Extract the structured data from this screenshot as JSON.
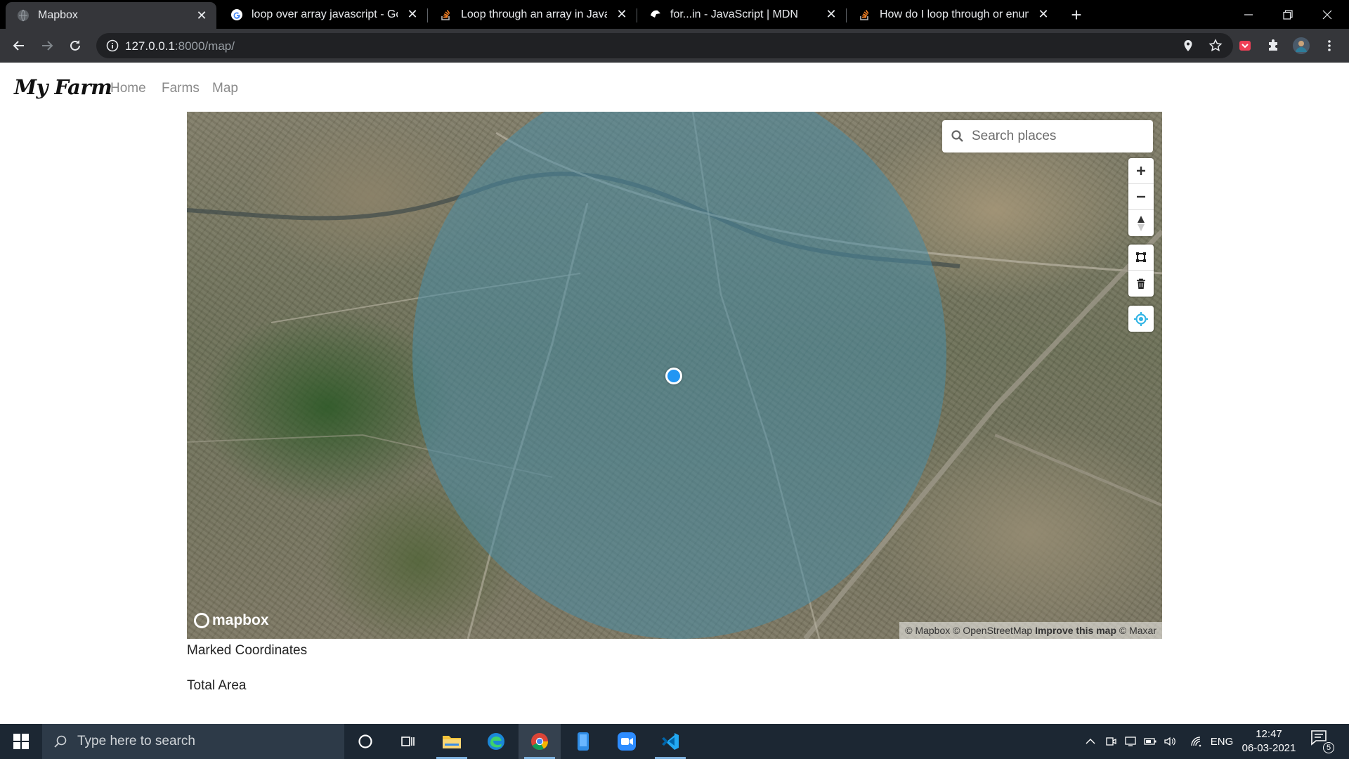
{
  "browser": {
    "tabs": [
      {
        "title": "Mapbox",
        "active": true
      },
      {
        "title": "loop over array javascript - Goog",
        "active": false
      },
      {
        "title": "Loop through an array in JavaScri",
        "active": false
      },
      {
        "title": "for...in - JavaScript | MDN",
        "active": false
      },
      {
        "title": "How do I loop through or enume",
        "active": false
      }
    ],
    "url_host": "127.0.0.1",
    "url_rest": ":8000/map/"
  },
  "navbar": {
    "brand": "My Farm",
    "links": [
      "Home",
      "Farms",
      "Map"
    ]
  },
  "map": {
    "search_placeholder": "Search places",
    "logo": "mapbox",
    "attribution_1": "© Mapbox © OpenStreetMap",
    "attribution_improve": "Improve this map",
    "attribution_2": "© Maxar",
    "drawn_circle_color": "#488ca5",
    "marker_color": "#2196f3"
  },
  "info": {
    "marked_coordinates_label": "Marked Coordinates",
    "total_area_label": "Total Area"
  },
  "taskbar": {
    "search_placeholder": "Type here to search",
    "language": "ENG",
    "time": "12:47",
    "date": "06-03-2021",
    "notification_count": "5"
  }
}
